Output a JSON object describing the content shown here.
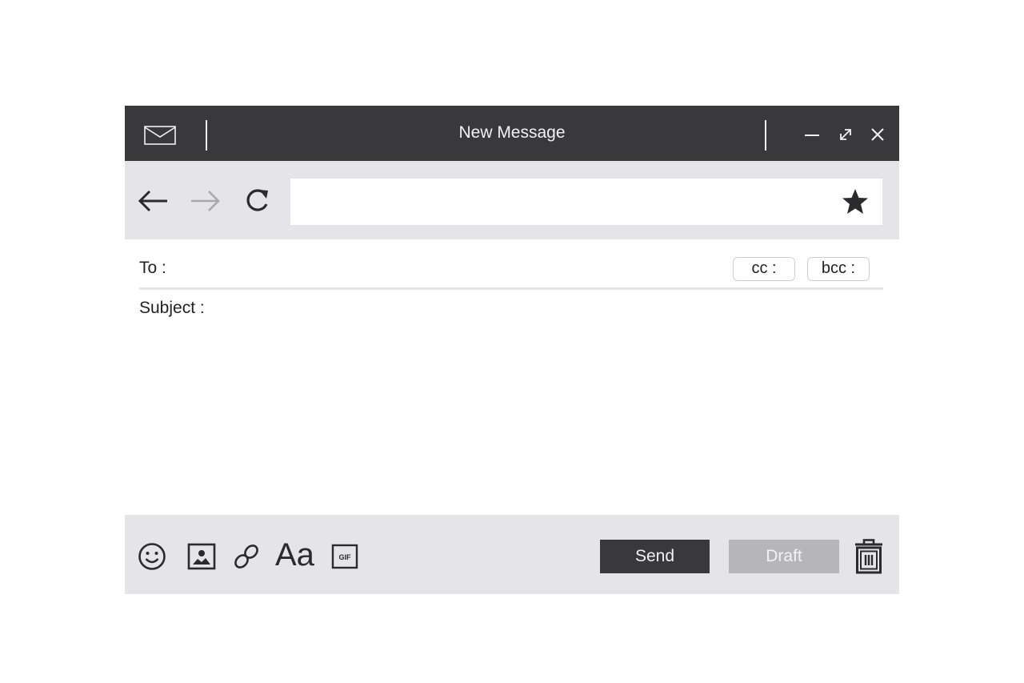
{
  "window": {
    "title": "New Message"
  },
  "titlebar_icons": {
    "app": "mail-icon",
    "minimize": "minimize-icon",
    "maximize": "expand-icon",
    "close": "close-icon"
  },
  "navbar": {
    "back": "arrow-left-icon",
    "forward": "arrow-right-icon",
    "reload": "reload-icon",
    "address_value": "",
    "bookmark": "star-icon"
  },
  "compose": {
    "to_label": "To :",
    "to_value": "",
    "cc_label": "cc :",
    "bcc_label": "bcc :",
    "subject_label": "Subject :",
    "subject_value": "",
    "body_value": ""
  },
  "toolbar": {
    "emoji": "smiley-icon",
    "image": "image-icon",
    "link": "link-icon",
    "font_label": "Aa",
    "gif_label": "GIF",
    "send_label": "Send",
    "draft_label": "Draft",
    "delete": "trash-icon"
  },
  "colors": {
    "titlebar": "#39393b",
    "panel": "#e4e4e9",
    "send_bg": "#39393b",
    "draft_bg": "#b6b6b8",
    "forward_disabled": "#a8a8ab"
  }
}
